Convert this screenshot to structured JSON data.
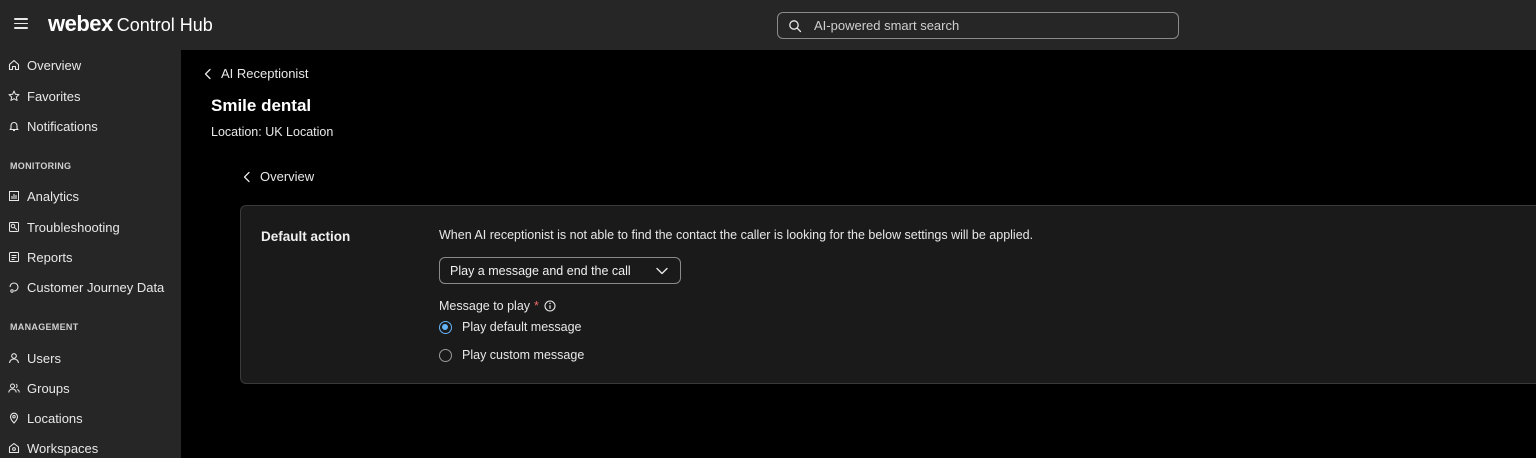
{
  "header": {
    "brand": "webex",
    "product": "Control Hub",
    "search_placeholder": "AI-powered smart search"
  },
  "sidebar": {
    "items_top": [
      {
        "label": "Overview",
        "icon": "home-icon"
      },
      {
        "label": "Favorites",
        "icon": "star-icon"
      },
      {
        "label": "Notifications",
        "icon": "bell-icon"
      }
    ],
    "monitoring_title": "MONITORING",
    "monitoring": [
      {
        "label": "Analytics",
        "icon": "bar-chart-icon"
      },
      {
        "label": "Troubleshooting",
        "icon": "troubleshoot-icon"
      },
      {
        "label": "Reports",
        "icon": "report-icon"
      },
      {
        "label": "Customer Journey Data",
        "icon": "journey-icon"
      }
    ],
    "management_title": "MANAGEMENT",
    "management": [
      {
        "label": "Users",
        "icon": "user-icon"
      },
      {
        "label": "Groups",
        "icon": "group-icon"
      },
      {
        "label": "Locations",
        "icon": "location-pin-icon"
      },
      {
        "label": "Workspaces",
        "icon": "workspace-icon"
      }
    ]
  },
  "main": {
    "back_label": "AI Receptionist",
    "title": "Smile dental",
    "location": "Location: UK Location",
    "sub_back_label": "Overview",
    "card": {
      "title": "Default action",
      "description": "When AI receptionist is not able to find the contact the caller is looking for the below settings will be applied.",
      "select_value": "Play a message and end the call",
      "field_label": "Message to play",
      "required_mark": "*",
      "radio_default": "Play default message",
      "radio_custom": "Play custom message"
    }
  },
  "colors": {
    "accent": "#64b4fa",
    "required": "#f06a6a",
    "chrome": "#262626",
    "background": "#000000"
  }
}
